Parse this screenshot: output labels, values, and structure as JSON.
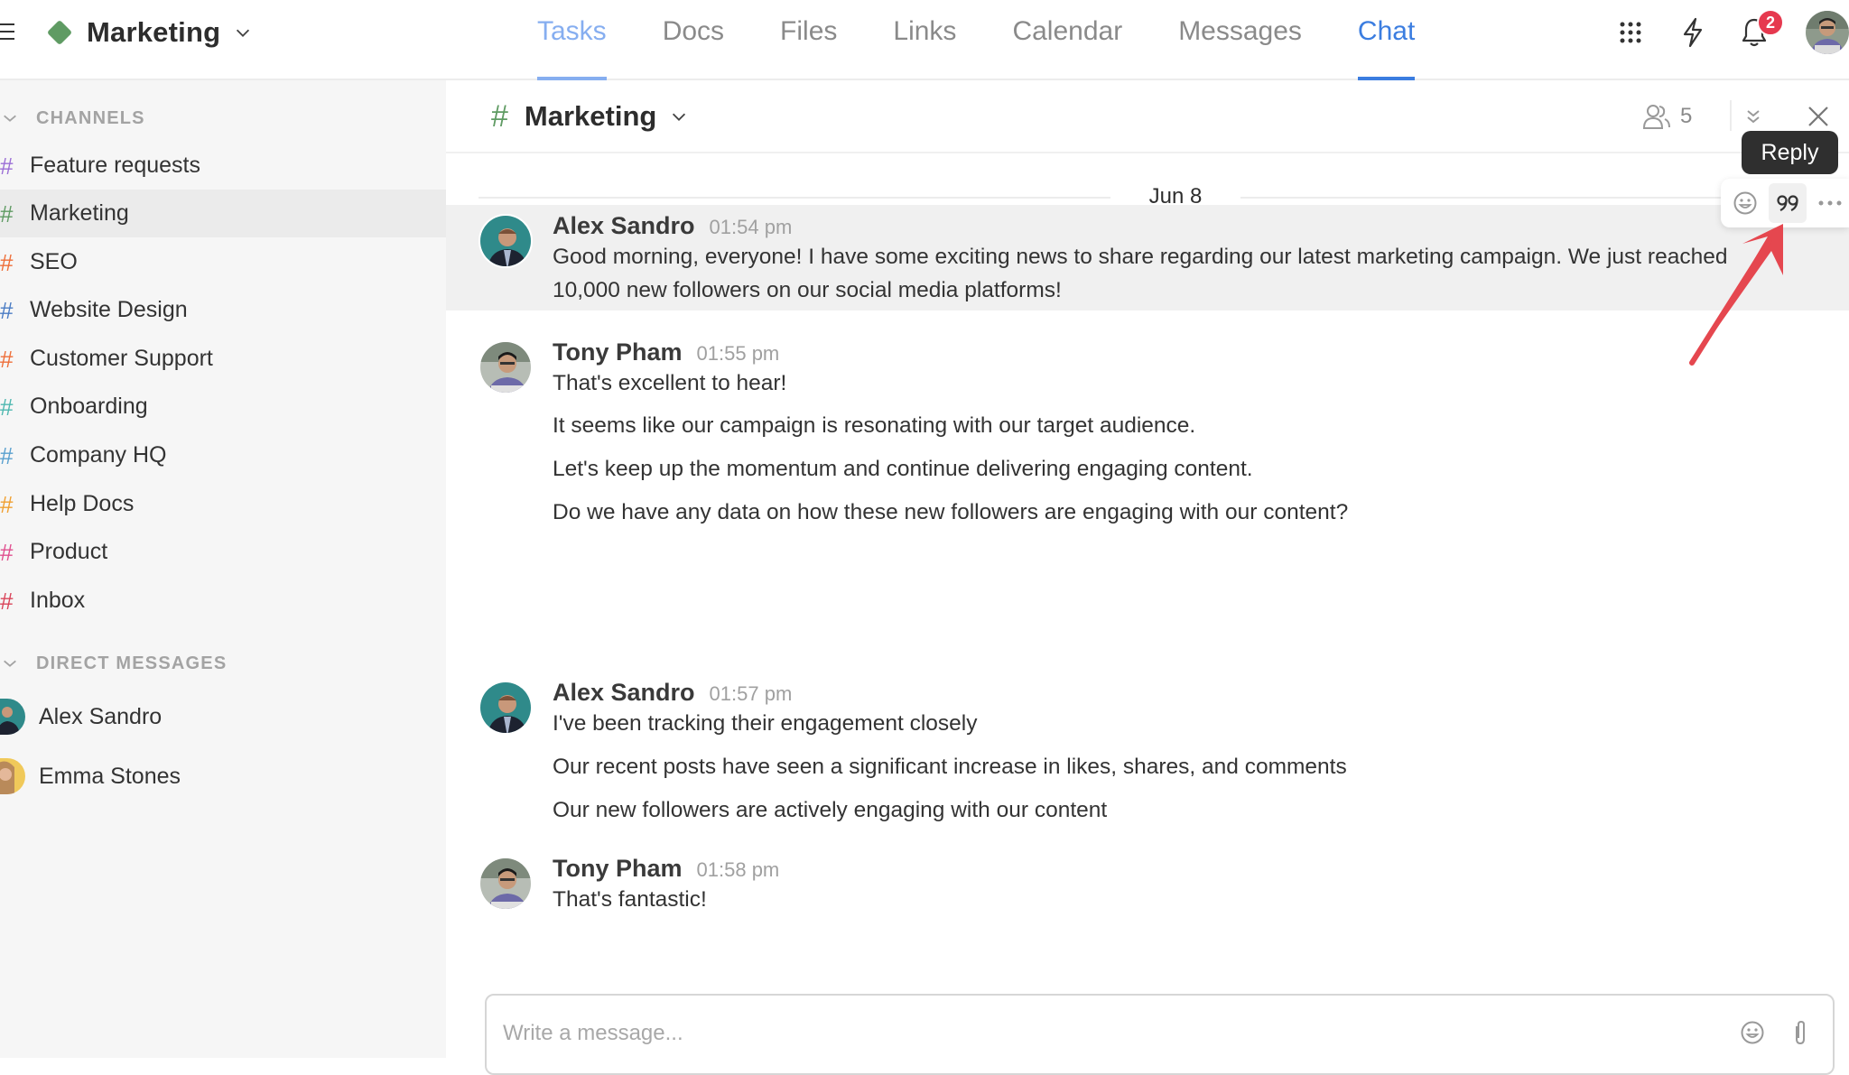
{
  "topbar": {
    "workspace": "Marketing",
    "workspace_color": "#5f9b63",
    "tabs": [
      {
        "label": "Tasks",
        "state": "hover"
      },
      {
        "label": "Docs",
        "state": "normal"
      },
      {
        "label": "Files",
        "state": "normal"
      },
      {
        "label": "Links",
        "state": "normal"
      },
      {
        "label": "Calendar",
        "state": "normal"
      },
      {
        "label": "Messages",
        "state": "normal"
      },
      {
        "label": "Chat",
        "state": "active"
      }
    ],
    "icons": [
      "apps-grid-icon",
      "lightning-icon",
      "bell-icon",
      "user-avatar"
    ],
    "notification_count": "2",
    "accent_color": "#3b7de0"
  },
  "sidebar": {
    "channels_header": "CHANNELS",
    "channels": [
      {
        "label": "Feature requests",
        "color": "#9b6fd6",
        "active": false
      },
      {
        "label": "Marketing",
        "color": "#5f9b63",
        "active": true
      },
      {
        "label": "SEO",
        "color": "#ee6f3a",
        "active": false
      },
      {
        "label": "Website Design",
        "color": "#4a7cc4",
        "active": false
      },
      {
        "label": "Customer Support",
        "color": "#ee6f3a",
        "active": false
      },
      {
        "label": "Onboarding",
        "color": "#4fb8b0",
        "active": false
      },
      {
        "label": "Company HQ",
        "color": "#5aa0cf",
        "active": false
      },
      {
        "label": "Help Docs",
        "color": "#f0a032",
        "active": false
      },
      {
        "label": "Product",
        "color": "#e0508f",
        "active": false
      },
      {
        "label": "Inbox",
        "color": "#d9455a",
        "active": false
      }
    ],
    "dm_header": "DIRECT MESSAGES",
    "direct_messages": [
      {
        "label": "Alex Sandro"
      },
      {
        "label": "Emma Stones"
      }
    ]
  },
  "channel": {
    "hash": "#",
    "title": "Marketing",
    "member_count": "5",
    "date_divider": "Jun 8"
  },
  "messages": [
    {
      "author": "Alex Sandro",
      "time": "01:54 pm",
      "lines": [
        "Good morning, everyone! I have some exciting news to share regarding our latest marketing campaign. We just reached",
        "10,000 new followers on our social media platforms!"
      ],
      "hovered": true
    },
    {
      "author": "Tony Pham",
      "time": "01:55 pm",
      "lines": [
        "That's excellent to hear!",
        "It seems like our campaign is resonating with our target audience.",
        "Let's keep up the momentum and continue delivering engaging content.",
        "Do we have any data on how these new followers are engaging with our content?"
      ],
      "hovered": false
    },
    {
      "author": "Alex Sandro",
      "time": "01:57 pm",
      "lines": [
        "I've been tracking their engagement closely",
        "Our recent posts have seen a significant increase in likes, shares, and comments",
        "Our new followers are actively engaging with our content"
      ],
      "hovered": false
    },
    {
      "author": "Tony Pham",
      "time": "01:58 pm",
      "lines": [
        "That's fantastic!"
      ],
      "hovered": false
    }
  ],
  "hover_toolbar": {
    "tooltip": "Reply",
    "actions": [
      "emoji-reaction",
      "reply",
      "more"
    ]
  },
  "composer": {
    "placeholder": "Write a message...",
    "value": ""
  },
  "annotation": {
    "arrow_color": "#e5474f"
  }
}
